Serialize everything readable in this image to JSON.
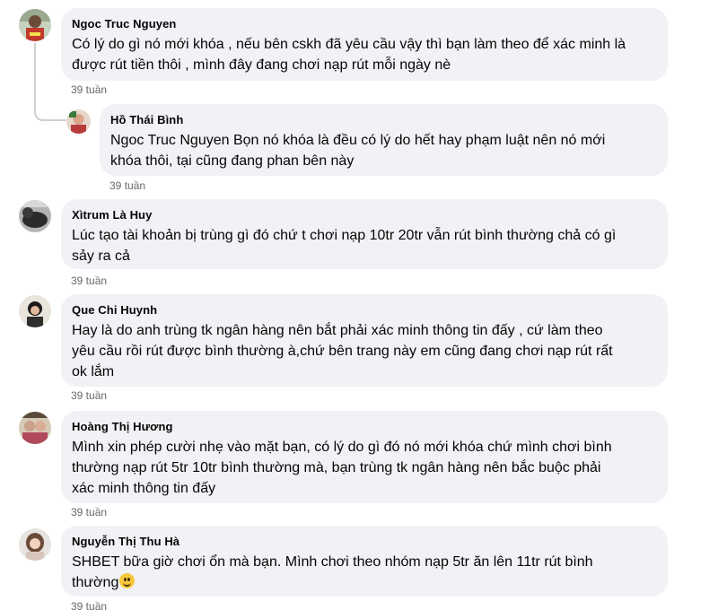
{
  "comments": [
    {
      "author": "Ngoc Truc Nguyen",
      "lines": [
        "Có lý do gì nó mới khóa , nếu bên cskh đã yêu cầu vậy thì bạn làm theo để xác minh là",
        "được rút tiền thôi , mình đây đang chơi nạp rút mỗi ngày nè"
      ],
      "time": "39 tuần"
    },
    {
      "author": "Hồ Thái Bình",
      "lines": [
        "Ngoc Truc Nguyen Bọn nó khóa là đều có lý do hết hay phạm luật nên nó mới",
        "khóa thôi, tại cũng đang phan bên này"
      ],
      "time": "39 tuần"
    },
    {
      "author": "Xìtrum Là Huy",
      "lines": [
        "Lúc tạo tài khoản bị trùng gì đó chứ t chơi nạp 10tr 20tr vẫn rút bình thường chả có gì",
        "sảy ra cả"
      ],
      "time": "39 tuần"
    },
    {
      "author": "Que Chi Huynh",
      "lines": [
        "Hay là do anh trùng tk ngân hàng nên bắt phải xác minh thông tin đấy , cứ làm theo",
        "yêu cầu rồi rút được bình thường à,chứ bên trang này em cũng đang chơi nạp rút rất",
        "ok lắm"
      ],
      "time": "39 tuần"
    },
    {
      "author": "Hoàng Thị Hương",
      "lines": [
        "Mình xin phép cười nhẹ vào mặt bạn, có lý do gì đó nó mới khóa chứ mình chơi bình",
        "thường nạp rút 5tr 10tr bình thường mà, bạn trùng tk ngân hàng nên bắc buộc phải",
        "xác minh thông tin đấy"
      ],
      "time": "39 tuần"
    },
    {
      "author": "Nguyễn Thị Thu Hà",
      "lines": [
        "SHBET bữa giờ chơi ổn mà bạn. Mình chơi theo nhóm nạp 5tr ăn lên 11tr rút bình",
        "thường"
      ],
      "emoji": "smiling-face-emoji",
      "time": "39 tuần"
    }
  ],
  "colors": {
    "bubble": "#f0f2f5",
    "meta": "#65676b",
    "text": "#050505",
    "thread_line": "#ced0d4"
  }
}
